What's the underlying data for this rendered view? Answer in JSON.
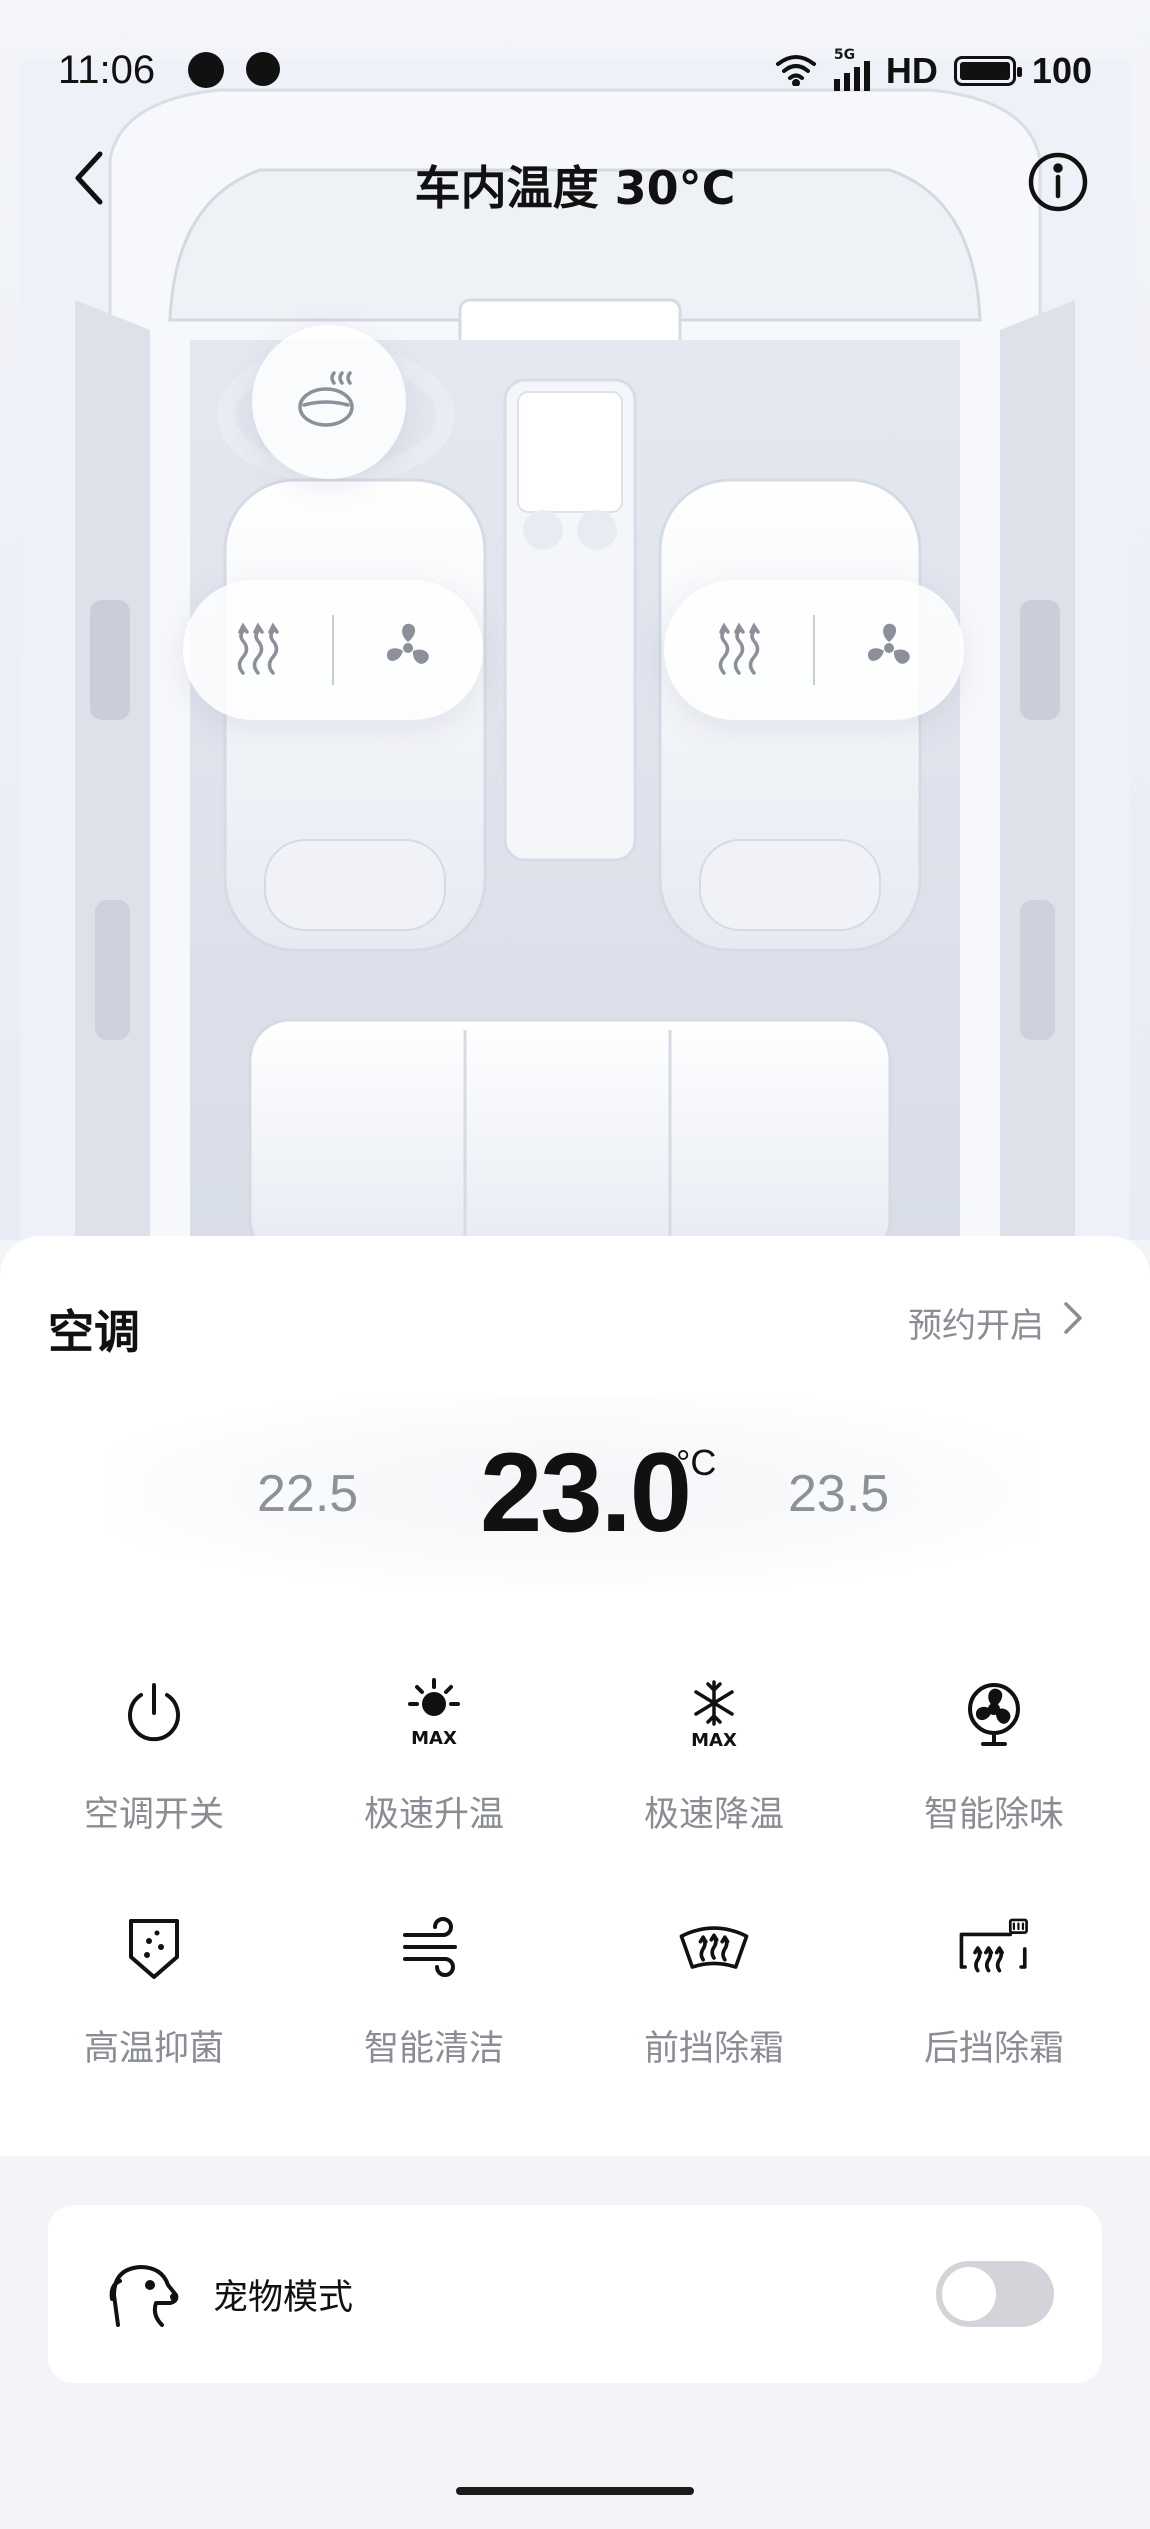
{
  "status_bar": {
    "time": "11:06",
    "network": "5G",
    "hd": "HD",
    "battery": "100"
  },
  "header": {
    "title": "车内温度 30°C",
    "back_icon": "chevron-left-icon",
    "info_icon": "info-icon"
  },
  "car_controls": {
    "steering_wheel_heat_icon": "steering-wheel-heat-icon",
    "left_seat": {
      "heat_icon": "seat-heat-icon",
      "vent_icon": "seat-fan-icon"
    },
    "right_seat": {
      "heat_icon": "seat-heat-icon",
      "vent_icon": "seat-fan-icon"
    }
  },
  "ac": {
    "title": "空调",
    "schedule_label": "预约开启",
    "temp_prev": "22.5",
    "temp_current": "23.0",
    "temp_unit": "°C",
    "temp_next": "23.5",
    "functions": [
      {
        "label": "空调开关",
        "icon": "power-icon"
      },
      {
        "label": "极速升温",
        "icon": "max-heat-icon"
      },
      {
        "label": "极速降温",
        "icon": "max-cool-icon"
      },
      {
        "label": "智能除味",
        "icon": "fan-deodorize-icon"
      },
      {
        "label": "高温抑菌",
        "icon": "sterilize-icon"
      },
      {
        "label": "智能清洁",
        "icon": "wind-clean-icon"
      },
      {
        "label": "前挡除霜",
        "icon": "front-defrost-icon"
      },
      {
        "label": "后挡除霜",
        "icon": "rear-defrost-icon"
      }
    ]
  },
  "pet_mode": {
    "label": "宠物模式",
    "icon": "dog-icon",
    "enabled": false
  },
  "colors": {
    "accent_text": "#111111",
    "secondary_text": "#8a8d94",
    "toggle_off": "#d2d4d9"
  }
}
